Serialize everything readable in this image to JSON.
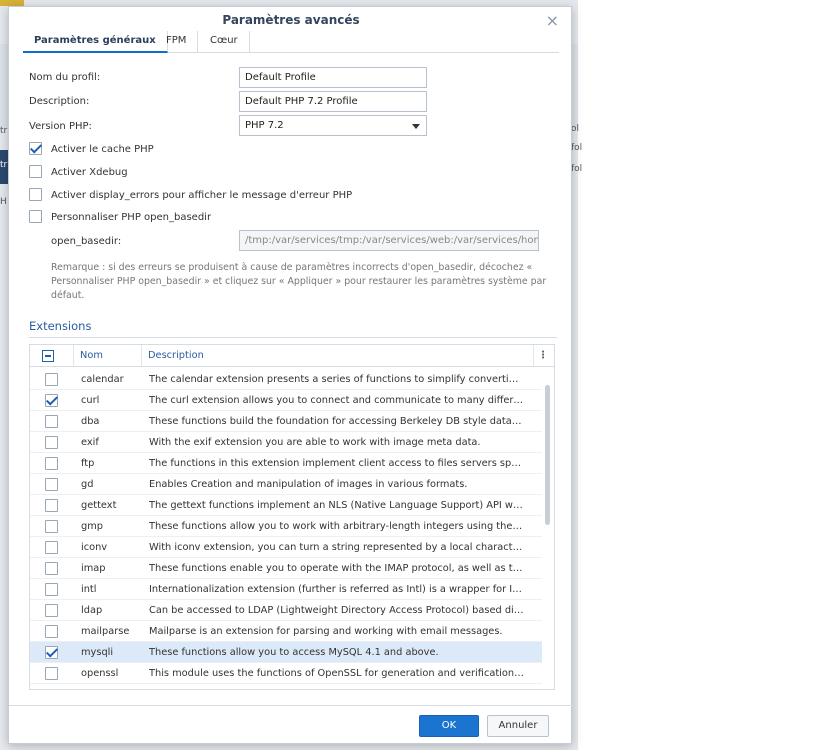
{
  "background": {
    "fragments": [
      "tr",
      "tr",
      "H"
    ],
    "right_fragments": [
      "ol",
      "fol",
      "fol"
    ]
  },
  "dialog": {
    "title": "Paramètres avancés",
    "close_glyph": "×",
    "tabs": [
      {
        "label": "Paramètres généraux",
        "active": true
      },
      {
        "label": "FPM",
        "active": false
      },
      {
        "label": "Cœur",
        "active": false
      }
    ]
  },
  "form": {
    "profile_name_label": "Nom du profil:",
    "profile_name_value": "Default Profile",
    "description_label": "Description:",
    "description_value": "Default PHP 7.2 Profile",
    "php_version_label": "Version PHP:",
    "php_version_value": "PHP 7.2",
    "php_cache_label": "Activer le cache PHP",
    "php_cache_checked": true,
    "xdebug_label": "Activer Xdebug",
    "xdebug_checked": false,
    "display_errors_label": "Activer display_errors pour afficher le message d'erreur PHP",
    "display_errors_checked": false,
    "open_basedir_custom_label": "Personnaliser PHP open_basedir",
    "open_basedir_custom_checked": false,
    "open_basedir_label": "open_basedir:",
    "open_basedir_value": "/tmp:/var/services/tmp:/var/services/web:/var/services/home",
    "remark": "Remarque : si des erreurs se produisent à cause de paramètres incorrects d'open_basedir, décochez « Personnaliser PHP open_basedir » et cliquez sur « Appliquer » pour restaurer les paramètres système par défaut."
  },
  "extensions": {
    "heading": "Extensions",
    "columns": {
      "name": "Nom",
      "description": "Description",
      "menu_glyph": "⋮"
    },
    "rows": [
      {
        "name": "calendar",
        "description": "The calendar extension presents a series of functions to simplify converting b...",
        "checked": false
      },
      {
        "name": "curl",
        "description": "The curl extension allows you to connect and communicate to many different ...",
        "checked": true
      },
      {
        "name": "dba",
        "description": "These functions build the foundation for accessing Berkeley DB style databas...",
        "checked": false
      },
      {
        "name": "exif",
        "description": "With the exif extension you are able to work with image meta data.",
        "checked": false
      },
      {
        "name": "ftp",
        "description": "The functions in this extension implement client access to files servers speaki...",
        "checked": false
      },
      {
        "name": "gd",
        "description": "Enables Creation and manipulation of images in various formats.",
        "checked": false
      },
      {
        "name": "gettext",
        "description": "The gettext functions implement an NLS (Native Language Support) API whic...",
        "checked": false
      },
      {
        "name": "gmp",
        "description": "These functions allow you to work with arbitrary-length integers using the G...",
        "checked": false
      },
      {
        "name": "iconv",
        "description": "With iconv extension, you can turn a string represented by a local character s...",
        "checked": false
      },
      {
        "name": "imap",
        "description": "These functions enable you to operate with the IMAP protocol, as well as the...",
        "checked": false
      },
      {
        "name": "intl",
        "description": "Internationalization extension (further is referred as Intl) is a wrapper for IC...",
        "checked": false
      },
      {
        "name": "ldap",
        "description": "Can be accessed to LDAP (Lightweight Directory Access Protocol) based direc...",
        "checked": false
      },
      {
        "name": "mailparse",
        "description": "Mailparse is an extension for parsing and working with email messages.",
        "checked": false
      },
      {
        "name": "mysqli",
        "description": "These functions allow you to access MySQL 4.1 and above.",
        "checked": true,
        "selected": true
      },
      {
        "name": "openssl",
        "description": "This module uses the functions of OpenSSL for generation and verification of ...",
        "checked": false
      }
    ]
  },
  "footer": {
    "ok_label": "OK",
    "cancel_label": "Annuler"
  }
}
